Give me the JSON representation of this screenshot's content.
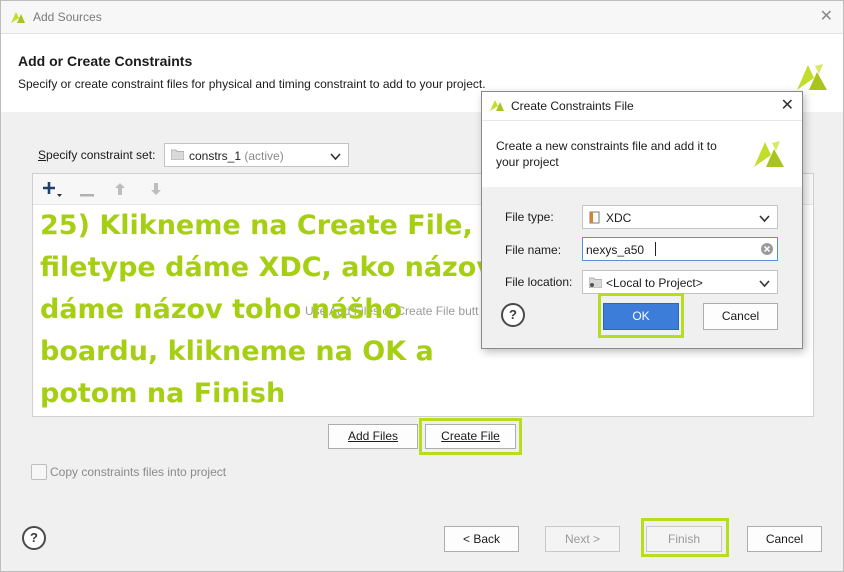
{
  "window": {
    "title": "Add Sources"
  },
  "header": {
    "heading": "Add or Create Constraints",
    "subheading": "Specify or create constraint files for physical and timing constraint to add to your project."
  },
  "constraint_set": {
    "label_first": "S",
    "label_rest": "pecify constraint set:",
    "value": "constrs_1",
    "value_suffix": "(active)"
  },
  "list": {
    "empty_hint": "Use Add Files or Create File butt"
  },
  "actions": {
    "add_files_label": "Add Files",
    "create_file_label": "Create File"
  },
  "copy_option": {
    "label": "Copy constraints files into project",
    "checked": false
  },
  "wizard": {
    "back_label": "< Back",
    "next_label": "Next >",
    "finish_label": "Finish",
    "cancel_label": "Cancel",
    "help_symbol": "?"
  },
  "dialog": {
    "title": "Create Constraints File",
    "description": "Create a new constraints file and add it to your project",
    "file_type_label": "File type:",
    "file_type_value": "XDC",
    "file_name_label": "File name:",
    "file_name_value": "nexys_a50",
    "file_location_label": "File location:",
    "file_location_value": "<Local to Project>",
    "ok_label": "OK",
    "cancel_label": "Cancel",
    "help_symbol": "?"
  },
  "overlay_note": {
    "lines": [
      "25) Klikneme na Create File,",
      "filetype dáme XDC, ako názov",
      "dáme názov  toho nášho",
      "boardu, klikneme na OK a",
      "potom na Finish"
    ]
  },
  "colors": {
    "highlight": "#b7dd1b",
    "overlay_text": "#a6cf14",
    "logo": "#c3dd2c",
    "ok_button": "#3b7dd8"
  },
  "icons": [
    "xilinx-logo-icon",
    "close-icon",
    "folder-icon",
    "chevron-down-icon",
    "plus-icon",
    "minus-icon",
    "arrow-up-icon",
    "arrow-down-icon",
    "help-icon",
    "file-icon",
    "clear-icon"
  ]
}
